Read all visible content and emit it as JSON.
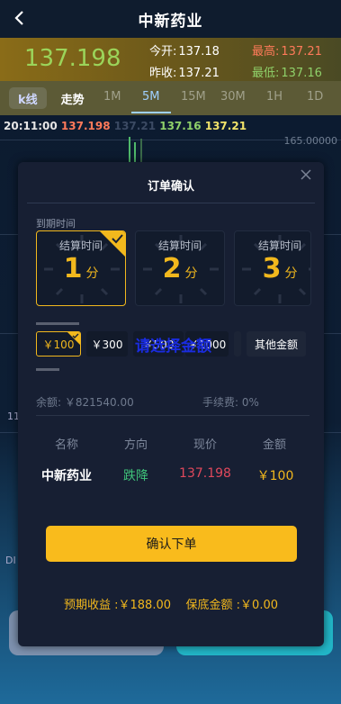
{
  "header": {
    "title": "中新药业",
    "back_icon": "chevron-left-icon"
  },
  "quote": {
    "price": "137.198",
    "open_label": "今开:",
    "open_value": "137.18",
    "high_label": "最高:",
    "high_value": "137.21",
    "prev_label": "昨收:",
    "prev_value": "137.21",
    "low_label": "最低:",
    "low_value": "137.16"
  },
  "tabs": {
    "kline": "k线",
    "trend": "走势",
    "timeframes": [
      "1M",
      "5M",
      "15M",
      "30M",
      "1H",
      "1D"
    ],
    "active_timeframe": "5M"
  },
  "ohlc": {
    "time": "20:11:00",
    "o": "137.198",
    "h": "137.21",
    "l": "137.16",
    "c": "137.21"
  },
  "chart": {
    "axis_label": "165.00000",
    "left_label_1": "11",
    "left_label_2": "DI"
  },
  "modal": {
    "title": "订单确认",
    "close_icon": "close-icon",
    "expiry_label": "到期时间",
    "time_cards": [
      {
        "label": "结算时间",
        "value": "1",
        "unit": "分",
        "selected": true
      },
      {
        "label": "结算时间",
        "value": "2",
        "unit": "分",
        "selected": false
      },
      {
        "label": "结算时间",
        "value": "3",
        "unit": "分",
        "selected": false
      }
    ],
    "amounts": [
      "￥100",
      "￥300",
      "￥500",
      "￥1000",
      "其他金额"
    ],
    "selected_amount": "￥100",
    "overlay_text": "请选择金额",
    "balance_label": "余额:",
    "balance_value": "￥821540.00",
    "fee_label": "手续费:",
    "fee_value": "0%",
    "columns": [
      "名称",
      "方向",
      "现价",
      "金额"
    ],
    "row": {
      "name": "中新药业",
      "direction": "跌降",
      "price": "137.198",
      "amount": "￥100"
    },
    "confirm_label": "确认下单",
    "expected_label": "预期收益 :",
    "expected_value": "￥188.00",
    "guarantee_label": "保底金额 :",
    "guarantee_value": "￥0.00"
  },
  "colors": {
    "accent": "#f9bb1c",
    "up": "#3fc47a",
    "down": "#e0485c",
    "modal_bg": "#171f33"
  }
}
